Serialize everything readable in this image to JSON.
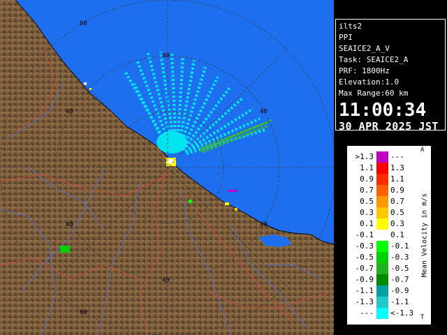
{
  "info": {
    "site": "ilts2",
    "mode": "PPI",
    "product": "SEAICE2_A_V",
    "task": "Task: SEAICE2_A",
    "prf": "PRF: 1800Hz",
    "elevation": "Elevation:1.0",
    "max_range": "Max Range:60 km",
    "time": "11:00:34",
    "date": "30 APR 2025 JST"
  },
  "ring_labels": [
    "60",
    "40",
    "40",
    "40",
    "40",
    "40",
    "60"
  ],
  "legend": {
    "title": "Mean Velocity in m/s",
    "top_marker": "A",
    "bottom_marker": "T",
    "rows": [
      {
        "left": ">1.3",
        "right": "---",
        "color": "#c000c0"
      },
      {
        "left": "1.1",
        "right": "1.3",
        "color": "#ff0000"
      },
      {
        "left": "0.9",
        "right": "1.1",
        "color": "#ff2a00"
      },
      {
        "left": "0.7",
        "right": "0.9",
        "color": "#ff6000"
      },
      {
        "left": "0.5",
        "right": "0.7",
        "color": "#ff9900"
      },
      {
        "left": "0.3",
        "right": "0.5",
        "color": "#ffc800"
      },
      {
        "left": "0.1",
        "right": "0.3",
        "color": "#ffff00"
      },
      {
        "left": "-0.1",
        "right": "0.1",
        "color": "#ffffff"
      },
      {
        "left": "-0.3",
        "right": "-0.1",
        "color": "#00ff00"
      },
      {
        "left": "-0.5",
        "right": "-0.3",
        "color": "#00d000"
      },
      {
        "left": "-0.7",
        "right": "-0.5",
        "color": "#20b020"
      },
      {
        "left": "-0.9",
        "right": "-0.7",
        "color": "#008a00"
      },
      {
        "left": "-1.1",
        "right": "-0.9",
        "color": "#00a0a0"
      },
      {
        "left": "-1.3",
        "right": "-1.1",
        "color": "#20c8c8"
      },
      {
        "left": "---",
        "right": "<-1.3",
        "color": "#00ffff"
      }
    ]
  },
  "colors": {
    "sea": "#1e6ff0",
    "land": "#7a5c3b",
    "rings": "#3c3c3c",
    "rivers": "#5a6ec8",
    "roads": "#c84a3a"
  }
}
